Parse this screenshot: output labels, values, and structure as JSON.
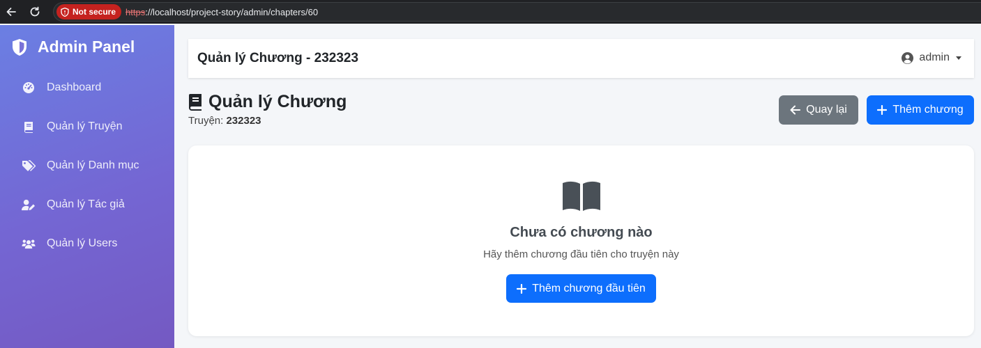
{
  "browser": {
    "security_label": "Not secure",
    "url_scheme": "https",
    "url_rest": "://localhost/project-story/admin/chapters/60"
  },
  "sidebar": {
    "brand": "Admin Panel",
    "items": [
      {
        "label": "Dashboard",
        "icon": "tachometer-icon"
      },
      {
        "label": "Quản lý Truyện",
        "icon": "book-icon"
      },
      {
        "label": "Quản lý Danh mục",
        "icon": "tags-icon"
      },
      {
        "label": "Quản lý Tác giả",
        "icon": "user-edit-icon"
      },
      {
        "label": "Quản lý Users",
        "icon": "users-icon"
      }
    ]
  },
  "topbar": {
    "title": "Quản lý Chương - 232323",
    "user": "admin"
  },
  "page": {
    "title": "Quản lý Chương",
    "story_label": "Truyện:",
    "story_name": "232323",
    "back_label": "Quay lại",
    "add_label": "Thêm chương"
  },
  "empty_state": {
    "title": "Chưa có chương nào",
    "description": "Hãy thêm chương đầu tiên cho truyện này",
    "button_label": "Thêm chương đầu tiên",
    "icon": "book-open-icon"
  },
  "colors": {
    "primary": "#0d6efd",
    "secondary": "#6c757d",
    "sidebar_start": "#6b7fe3",
    "sidebar_end": "#7459c2",
    "insecure": "#c5221f"
  }
}
